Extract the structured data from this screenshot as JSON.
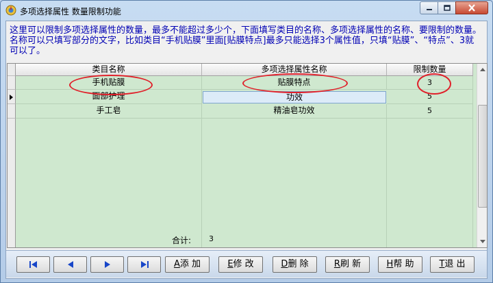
{
  "window": {
    "title": "多项选择属性 数量限制功能"
  },
  "description": "这里可以限制多项选择属性的数量，最多不能超过多少个，下面填写类目的名称、多项选择属性的名称、要限制的数量。名称可以只填写部分的文字，比如类目“手机贴膜”里面[贴膜特点]最多只能选择3个属性值，只填“贴膜”、“特点”、3就可以了。",
  "table": {
    "columns": [
      "类目名称",
      "多项选择属性名称",
      "限制数量"
    ],
    "rows": [
      {
        "category": "手机贴膜",
        "attribute": "贴膜特点",
        "limit": "3"
      },
      {
        "category": "面部护理",
        "attribute": "功效",
        "limit": "5"
      },
      {
        "category": "手工皂",
        "attribute": "精油皂功效",
        "limit": "5"
      }
    ],
    "total_label": "合计:",
    "total_value": "3"
  },
  "toolbar": {
    "nav_first_icon": "first-icon",
    "nav_prev_icon": "prev-icon",
    "nav_next_icon": "next-icon",
    "nav_last_icon": "last-icon",
    "add_key": "A",
    "add_label": "添 加",
    "edit_key": "E",
    "edit_label": "修 改",
    "delete_key": "D",
    "delete_label": "删 除",
    "refresh_key": "R",
    "refresh_label": "刷 新",
    "help_key": "H",
    "help_label": "帮 助",
    "exit_key": "T",
    "exit_label": "退 出"
  },
  "colors": {
    "grid_background": "#cfe8cf",
    "description_text": "#0000b4",
    "annotation": "#e0202a"
  }
}
